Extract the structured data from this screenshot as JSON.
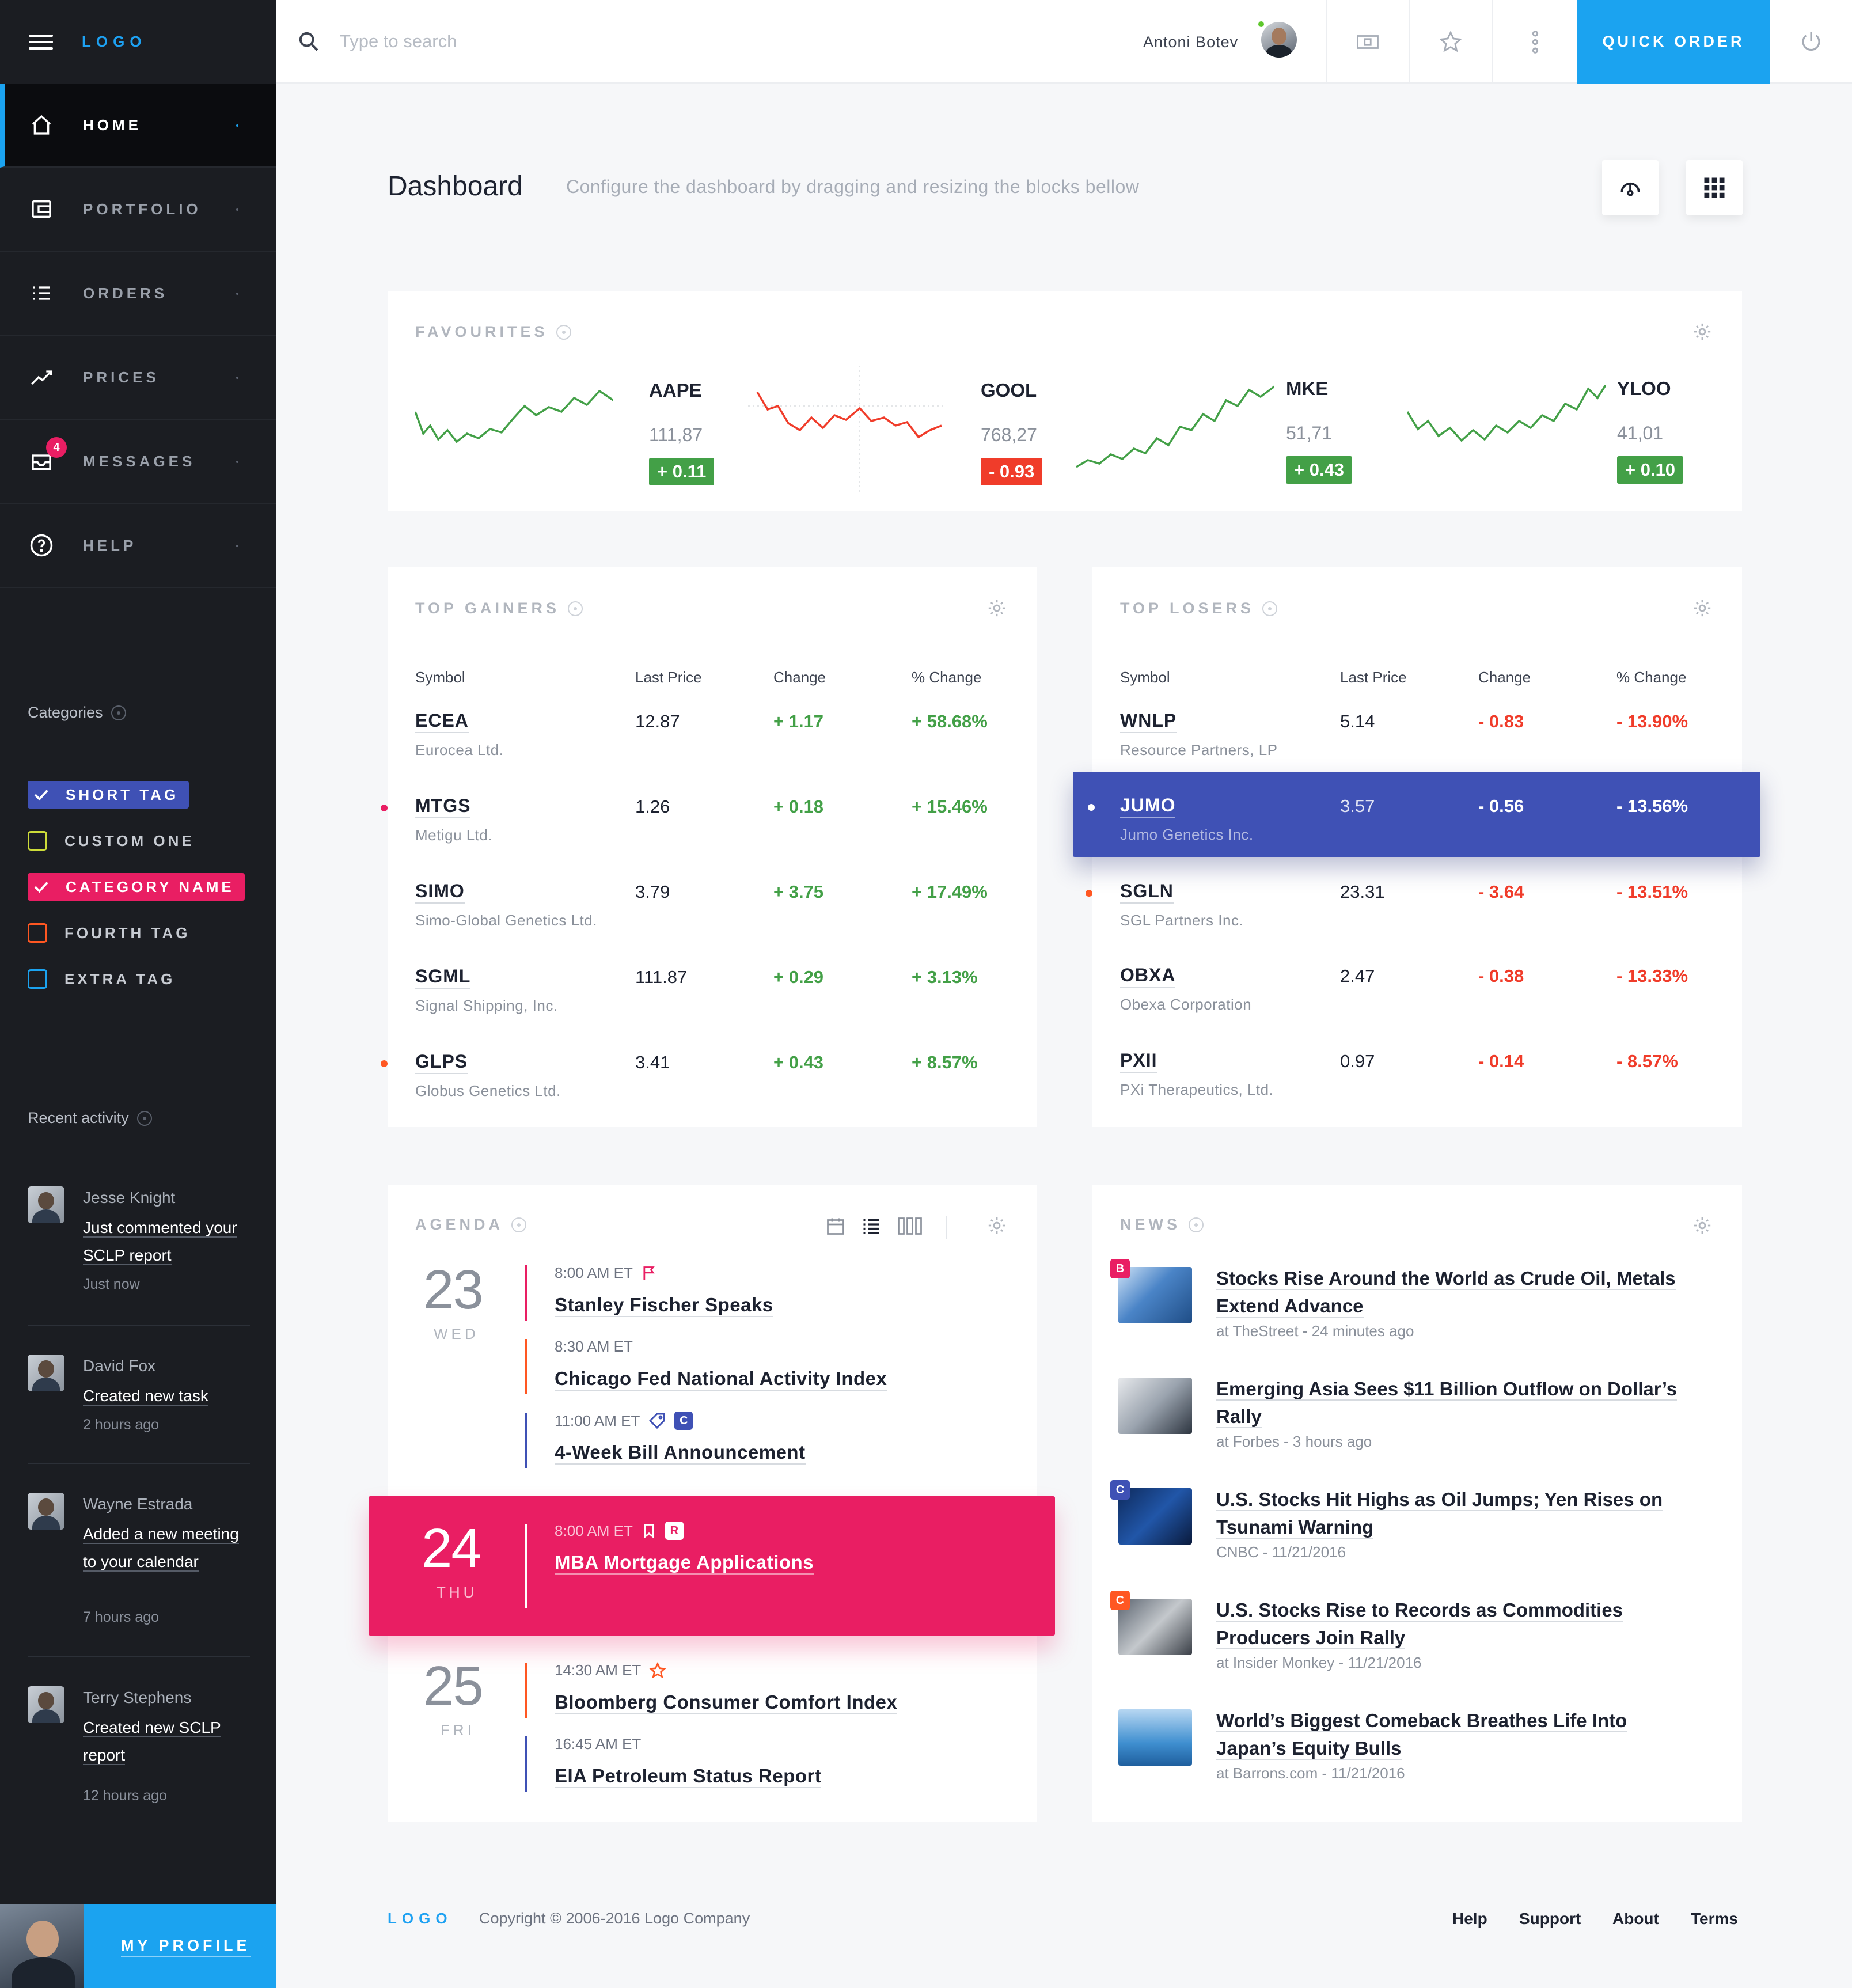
{
  "sidebar": {
    "logo": "LOGO",
    "nav": [
      {
        "label": "HOME"
      },
      {
        "label": "PORTFOLIO"
      },
      {
        "label": "ORDERS"
      },
      {
        "label": "PRICES"
      },
      {
        "label": "MESSAGES",
        "badge": "4"
      },
      {
        "label": "HELP"
      }
    ],
    "categories_title": "Categories",
    "tags": [
      {
        "label": "SHORT TAG",
        "color": "#3f51b5",
        "checked": true
      },
      {
        "label": "CUSTOM ONE",
        "color": "#cddc39",
        "checked": false
      },
      {
        "label": "CATEGORY NAME",
        "color": "#e91e63",
        "checked": true
      },
      {
        "label": "FOURTH TAG",
        "color": "#ff5722",
        "checked": false
      },
      {
        "label": "EXTRA TAG",
        "color": "#1ba3f0",
        "checked": false
      }
    ],
    "recent_title": "Recent activity",
    "activity": [
      {
        "name": "Jesse Knight",
        "text": "Just commented your SCLP report",
        "time": "Just now"
      },
      {
        "name": "David Fox",
        "text": "Created new task",
        "time": "2 hours ago"
      },
      {
        "name": "Wayne Estrada",
        "text": "Added a new meeting to your calendar",
        "time": "7 hours ago"
      },
      {
        "name": "Terry Stephens",
        "text": "Created new SCLP report",
        "time": "12 hours ago"
      }
    ],
    "profile_label": "MY PROFILE"
  },
  "topbar": {
    "search_placeholder": "Type to search",
    "user_name": "Antoni Botev",
    "quick_order": "QUICK ORDER"
  },
  "header": {
    "title": "Dashboard",
    "subtitle": "Configure the dashboard by dragging and resizing the blocks bellow"
  },
  "favourites": {
    "title": "FAVOURITES",
    "items": [
      {
        "symbol": "AAPE",
        "price": "111,87",
        "change": "+ 0.11",
        "up": true
      },
      {
        "symbol": "GOOL",
        "price": "768,27",
        "change": "- 0.93",
        "up": false
      },
      {
        "symbol": "MKE",
        "price": "51,71",
        "change": "+ 0.43",
        "up": true
      },
      {
        "symbol": "YLOO",
        "price": "41,01",
        "change": "+ 0.10",
        "up": true
      }
    ]
  },
  "table_headers": [
    "Symbol",
    "Last Price",
    "Change",
    "% Change"
  ],
  "gainers": {
    "title": "TOP GAINERS",
    "rows": [
      {
        "symbol": "ECEA",
        "company": "Eurocea Ltd.",
        "price": "12.87",
        "change": "+ 1.17",
        "pct": "+ 58.68%"
      },
      {
        "symbol": "MTGS",
        "company": "Metigu Ltd.",
        "price": "1.26",
        "change": "+ 0.18",
        "pct": "+ 15.46%"
      },
      {
        "symbol": "SIMO",
        "company": "Simo-Global Genetics Ltd.",
        "price": "3.79",
        "change": "+ 3.75",
        "pct": "+ 17.49%"
      },
      {
        "symbol": "SGML",
        "company": "Signal Shipping, Inc.",
        "price": "111.87",
        "change": "+ 0.29",
        "pct": "+ 3.13%"
      },
      {
        "symbol": "GLPS",
        "company": "Globus Genetics Ltd.",
        "price": "3.41",
        "change": "+ 0.43",
        "pct": "+ 8.57%"
      }
    ]
  },
  "losers": {
    "title": "TOP LOSERS",
    "rows": [
      {
        "symbol": "WNLP",
        "company": "Resource Partners, LP",
        "price": "5.14",
        "change": "- 0.83",
        "pct": "- 13.90%"
      },
      {
        "symbol": "JUMO",
        "company": "Jumo Genetics Inc.",
        "price": "3.57",
        "change": "- 0.56",
        "pct": "- 13.56%"
      },
      {
        "symbol": "SGLN",
        "company": "SGL Partners Inc.",
        "price": "23.31",
        "change": "- 3.64",
        "pct": "- 13.51%"
      },
      {
        "symbol": "OBXA",
        "company": "Obexa Corporation",
        "price": "2.47",
        "change": "- 0.38",
        "pct": "- 13.33%"
      },
      {
        "symbol": "PXII",
        "company": "PXi Therapeutics, Ltd.",
        "price": "0.97",
        "change": "- 0.14",
        "pct": "- 8.57%"
      }
    ]
  },
  "agenda": {
    "title": "AGENDA",
    "days": [
      {
        "num": "23",
        "name": "WED"
      },
      {
        "num": "24",
        "name": "THU"
      },
      {
        "num": "25",
        "name": "FRI"
      }
    ],
    "events": [
      {
        "time": "8:00 AM ET",
        "title": "Stanley Fischer Speaks"
      },
      {
        "time": "8:30 AM ET",
        "title": "Chicago Fed National Activity Index"
      },
      {
        "time": "11:00 AM ET",
        "title": "4-Week Bill Announcement",
        "badge": "C"
      },
      {
        "time": "8:00 AM ET",
        "title": "MBA Mortgage Applications",
        "badge": "R"
      },
      {
        "time": "14:30 AM ET",
        "title": "Bloomberg Consumer Comfort Index"
      },
      {
        "time": "16:45 AM ET",
        "title": "EIA Petroleum Status Report"
      }
    ]
  },
  "news": {
    "title": "NEWS",
    "items": [
      {
        "badge": "B",
        "badge_color": "#e91e63",
        "title": "Stocks Rise Around the World as Crude Oil, Metals Extend Advance",
        "source": "at TheStreet - 24 minutes ago"
      },
      {
        "badge": "",
        "badge_color": "",
        "title": "Emerging Asia Sees $11 Billion Outflow on Dollar’s Rally",
        "source": "at Forbes - 3 hours ago"
      },
      {
        "badge": "C",
        "badge_color": "#3f51b5",
        "title": "U.S. Stocks Hit Highs as Oil Jumps; Yen Rises on Tsunami Warning",
        "source": "CNBC - 11/21/2016"
      },
      {
        "badge": "C",
        "badge_color": "#ff5722",
        "title": "U.S. Stocks Rise to Records as Commodities Producers Join Rally",
        "source": "at Insider Monkey - 11/21/2016"
      },
      {
        "badge": "",
        "badge_color": "",
        "title": "World’s Biggest Comeback Breathes Life Into Japan’s Equity Bulls",
        "source": "at Barrons.com - 11/21/2016"
      }
    ]
  },
  "footer": {
    "logo": "LOGO",
    "copyright": "Copyright © 2006-2016 Logo Company",
    "links": [
      "Help",
      "Support",
      "About",
      "Terms"
    ]
  },
  "colors": {
    "accent": "#1ba3f0",
    "up": "#43a047",
    "down": "#f03c2a",
    "highlight_row": "#3f51b5",
    "highlight_agenda": "#e91e63"
  }
}
